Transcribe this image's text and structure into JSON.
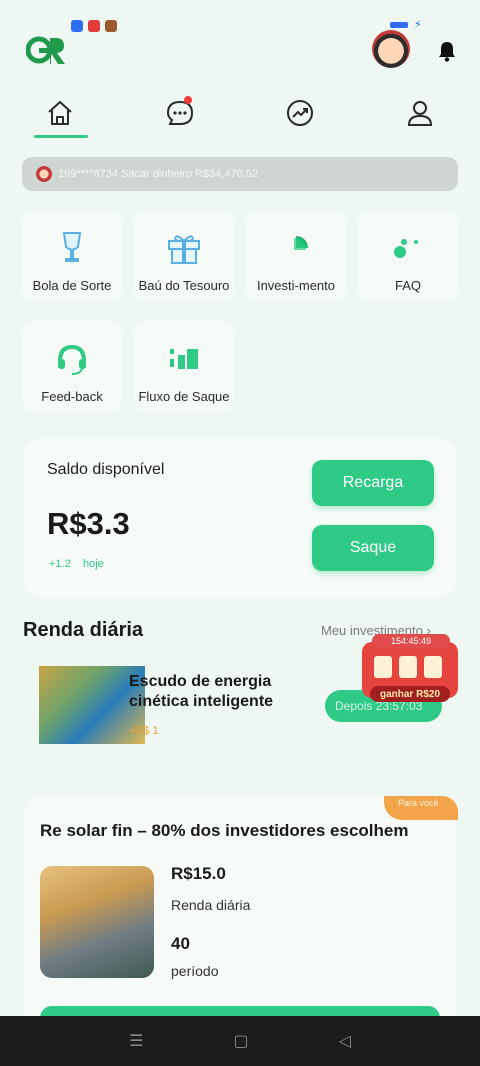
{
  "header": {
    "logo_text": "GR",
    "notification_icons": [
      "blue-app-icon",
      "red-app-icon",
      "brown-app-icon"
    ]
  },
  "nav": {
    "tabs": [
      {
        "name": "home",
        "icon": "home-icon",
        "active": true
      },
      {
        "name": "messages",
        "icon": "chat-icon",
        "badge": true
      },
      {
        "name": "trends",
        "icon": "trend-icon"
      },
      {
        "name": "profile",
        "icon": "user-icon"
      }
    ]
  },
  "ticker": {
    "text": "199****8734 Sacar dinheiro R$34,470.52"
  },
  "features": [
    {
      "label": "Bola de Sorte",
      "icon": "trophy-icon"
    },
    {
      "label": "Baú do Tesouro",
      "icon": "gift-box-icon"
    },
    {
      "label": "Investi-mento",
      "icon": "pie-chart-icon"
    },
    {
      "label": "FAQ",
      "icon": "faq-icon"
    },
    {
      "label": "Feed-back",
      "icon": "headset-icon"
    },
    {
      "label": "Fluxo de Saque",
      "icon": "bar-chart-icon"
    }
  ],
  "balance": {
    "label": "Saldo disponível",
    "amount": "R$3.3",
    "delta": "+1.2",
    "delta_label": "hoje",
    "recharge_label": "Recarga",
    "withdraw_label": "Saque"
  },
  "daily_income": {
    "title": "Renda diária",
    "link_label": "Meu investimento",
    "item": {
      "name": "Escudo de energia cinética inteligente",
      "earning": "+R$ 1",
      "timer_label": "Depois 23:57:03"
    }
  },
  "slot_widget": {
    "timer": "154:45:49",
    "prize": "ganhar R$20"
  },
  "promo": {
    "badge": "Para você",
    "title": "Re solar fin – 80% dos investidores escolhem",
    "price": "R$15.0",
    "price_label": "Renda diária",
    "period": "40",
    "period_label": "período"
  },
  "colors": {
    "accent": "#2fca86",
    "background": "#eef7f2",
    "card": "#f6fbf8",
    "orange": "#f3a34a"
  }
}
